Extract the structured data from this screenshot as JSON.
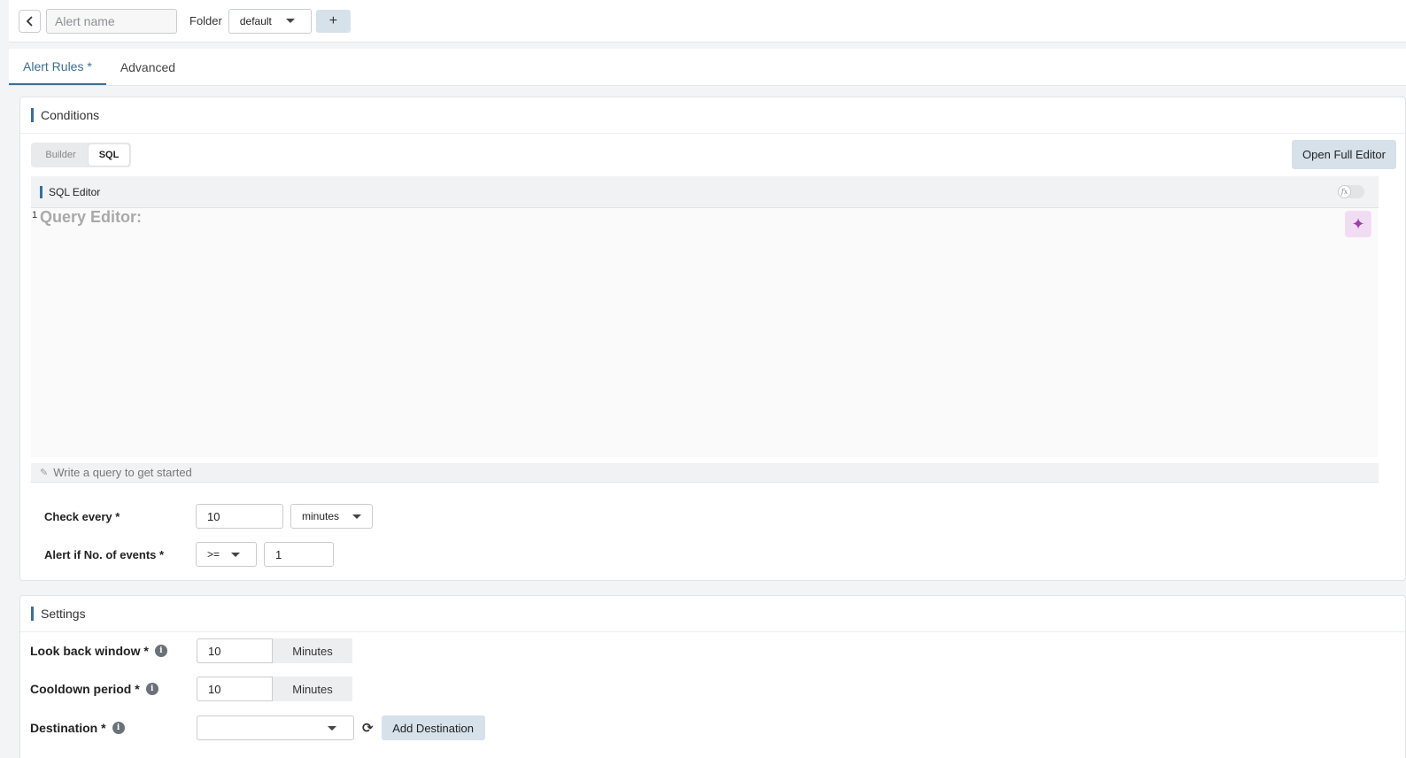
{
  "header": {
    "alert_name_placeholder": "Alert name",
    "folder_label": "Folder",
    "folder_value": "default",
    "add_folder_label": "+"
  },
  "tabs": [
    {
      "label": "Alert Rules *"
    },
    {
      "label": "Advanced"
    }
  ],
  "conditions": {
    "title": "Conditions",
    "mode_options": [
      "Builder",
      "SQL"
    ],
    "open_full_editor_label": "Open Full Editor",
    "sql_editor_title": "SQL Editor",
    "fx_symbol": "fx",
    "line_number": "1",
    "query_placeholder": "Query Editor:",
    "ai_icon": "✦",
    "footer_hint": "Write a query to get started",
    "pencil_icon": "✎",
    "check_every_label": "Check every *",
    "check_every_value": "10",
    "check_every_unit": "minutes",
    "alert_if_label": "Alert if No. of events *",
    "operator_value": ">=",
    "threshold_value": "1"
  },
  "settings": {
    "title": "Settings",
    "look_back_label": "Look back window *",
    "look_back_value": "10",
    "look_back_unit": "Minutes",
    "cooldown_label": "Cooldown period *",
    "cooldown_value": "10",
    "cooldown_unit": "Minutes",
    "destination_label": "Destination *",
    "info_symbol": "i",
    "refresh_icon": "⟳",
    "add_destination_label": "Add Destination"
  },
  "colors": {
    "accent": "#3b6f93",
    "button_bg": "#d6e1ea",
    "ai_button_bg": "#f1ddf3",
    "ai_icon_color": "#a13bb0"
  }
}
